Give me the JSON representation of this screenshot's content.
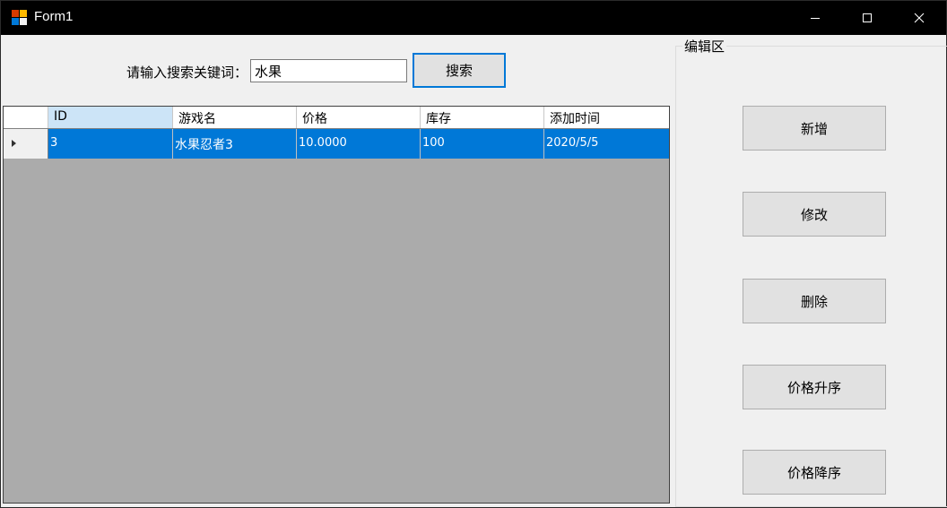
{
  "window": {
    "title": "Form1",
    "icon": "winforms-app-icon",
    "controls": [
      "minimize-icon",
      "maximize-icon",
      "close-icon"
    ]
  },
  "search": {
    "label": "请输入搜索关键词：",
    "value": "水果",
    "button_label": "搜索"
  },
  "grid": {
    "columns": [
      "ID",
      "游戏名",
      "价格",
      "库存",
      "添加时间"
    ],
    "rows": [
      {
        "id": "3",
        "name": "水果忍者3",
        "price": "10.0000",
        "stock": "100",
        "added": "2020/5/5"
      }
    ]
  },
  "editor": {
    "group_title": "编辑区",
    "buttons": {
      "add": "新增",
      "edit": "修改",
      "delete": "删除",
      "sort_asc": "价格升序",
      "sort_desc": "价格降序"
    }
  },
  "colors": {
    "selection": "#0078d7",
    "titlebar": "#000000",
    "grid_background": "#ababab"
  }
}
